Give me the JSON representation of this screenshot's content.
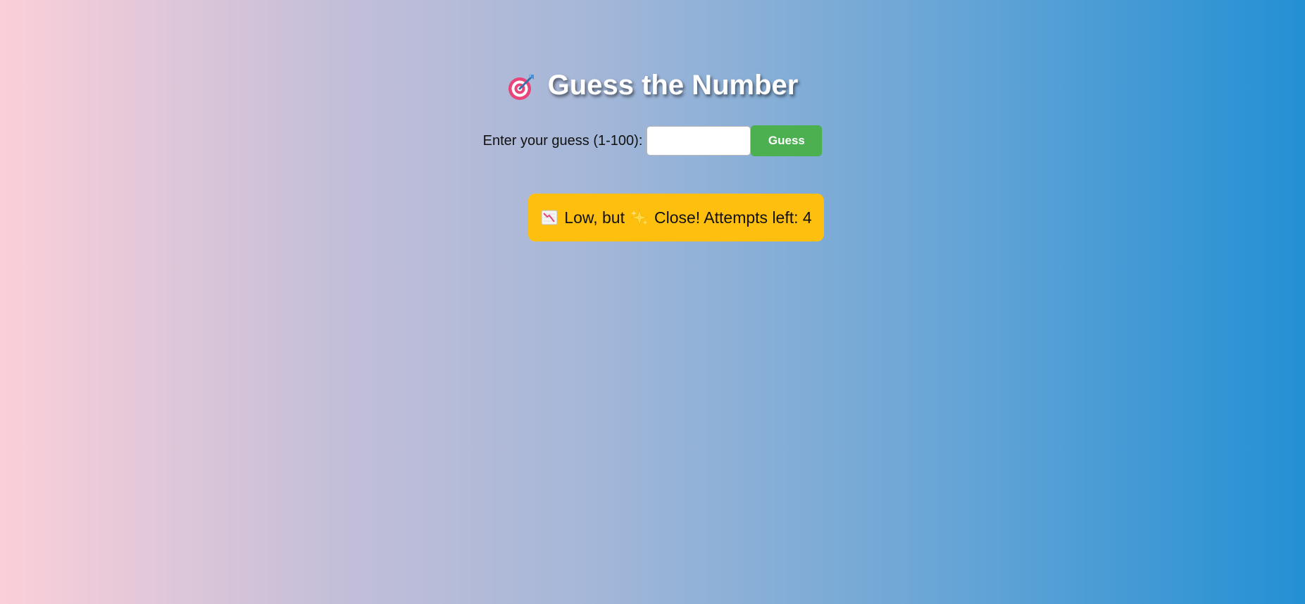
{
  "app": {
    "title": "Guess the Number",
    "title_icon": "target-icon"
  },
  "guess_form": {
    "label": "Enter your guess (1-100):",
    "input_value": "",
    "input_placeholder": "",
    "button_label": "Guess"
  },
  "feedback": {
    "leading_icon": "chart-decreasing-icon",
    "text_before_icon": "Low, but",
    "middle_icon": "sparkles-icon",
    "text_after_icon": "Close! Attempts left: 4",
    "background_color": "#ffbf0e"
  },
  "colors": {
    "button": "#4caf50",
    "gradient_left": "#fbcfd9",
    "gradient_right": "#2390d4"
  }
}
